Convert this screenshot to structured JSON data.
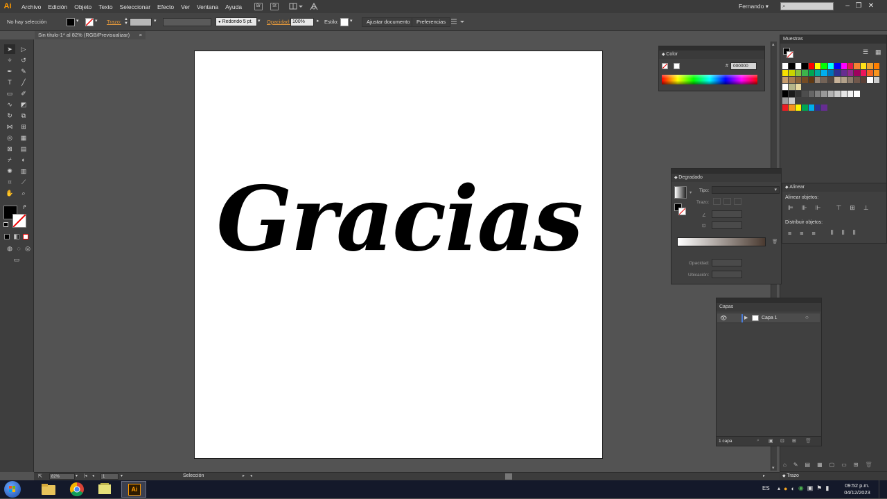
{
  "app": {
    "logo": "Ai",
    "menu": [
      "Archivo",
      "Edición",
      "Objeto",
      "Texto",
      "Seleccionar",
      "Efecto",
      "Ver",
      "Ventana",
      "Ayuda"
    ],
    "user": "Fernando",
    "bridge_icon": "Br",
    "stock_icon": "St"
  },
  "control_bar": {
    "selection_status": "No hay selección",
    "stroke_label": "Trazo:",
    "brush_label": "Redondo 5 pt.",
    "opacity_label": "Opacidad:",
    "opacity_value": "100%",
    "style_label": "Estilo:",
    "doc_setup_button": "Ajustar documento",
    "preferences_button": "Preferencias"
  },
  "document": {
    "tab_title": "Sin título-1* al 82% (RGB/Previsualizar)",
    "tab_close": "×",
    "artwork_text": "Gracias"
  },
  "panels": {
    "swatches": {
      "title": "Muestras"
    },
    "color": {
      "title": "Color",
      "hex_prefix": "#",
      "hex_value": "000000"
    },
    "gradient": {
      "title": "Degradado",
      "type_label": "Tipo:",
      "stroke_label": "Trazo:",
      "opacity_label": "Opacidad:",
      "location_label": "Ubicación:"
    },
    "align": {
      "title": "Alinear",
      "align_objects_label": "Alinear objetos:",
      "distribute_objects_label": "Distribuir objetos:"
    },
    "layers": {
      "title": "Capas",
      "layer_name": "Capa 1",
      "layer_count": "1 capa"
    },
    "stroke_collapsed": {
      "title": "Trazo"
    }
  },
  "status_bar": {
    "zoom": "82%",
    "artboard_number": "1",
    "tool_name": "Selección"
  },
  "taskbar": {
    "language": "ES",
    "time": "09:52 p.m.",
    "date": "04/12/2023"
  },
  "colors": {
    "accent_orange": "#ff9a00",
    "panel_bg": "#404040",
    "workspace_bg": "#535353"
  }
}
